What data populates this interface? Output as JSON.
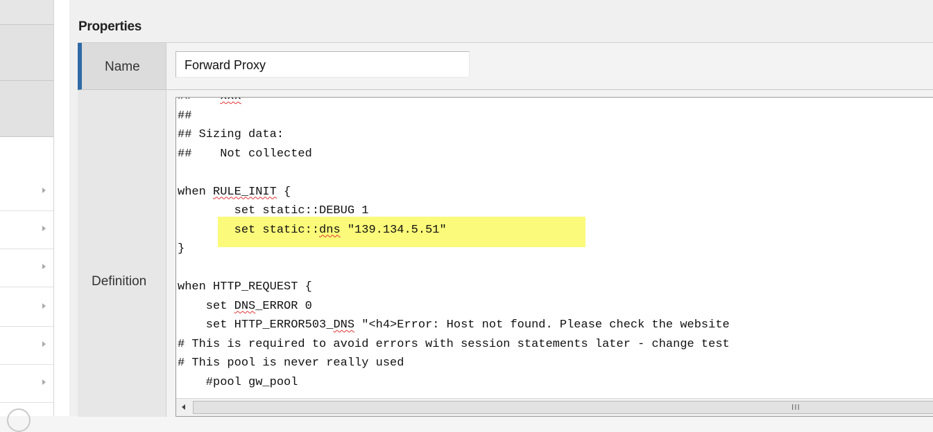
{
  "properties": {
    "title": "Properties",
    "name_label": "Name",
    "name_value": "Forward Proxy",
    "definition_label": "Definition"
  },
  "editor": {
    "lines": [
      [
        {
          "t": "##    "
        },
        {
          "t": "xxx",
          "sq": true
        }
      ],
      [
        {
          "t": "##"
        }
      ],
      [
        {
          "t": "## Sizing data:"
        }
      ],
      [
        {
          "t": "##    Not collected"
        }
      ],
      [
        {
          "t": ""
        }
      ],
      [
        {
          "t": "when "
        },
        {
          "t": "RULE_INIT",
          "sq": true
        },
        {
          "t": " {"
        }
      ],
      [
        {
          "t": "        set static::DEBUG 1"
        }
      ],
      [
        {
          "t": "        set static::"
        },
        {
          "t": "dns",
          "sq": true
        },
        {
          "t": " \"139.134.5.51\""
        }
      ],
      [
        {
          "t": "}"
        }
      ],
      [
        {
          "t": ""
        }
      ],
      [
        {
          "t": "when HTTP_REQUEST {"
        }
      ],
      [
        {
          "t": "    set "
        },
        {
          "t": "DNS",
          "sq": true
        },
        {
          "t": "_ERROR 0"
        }
      ],
      [
        {
          "t": "    set HTTP_ERROR503_"
        },
        {
          "t": "DNS",
          "sq": true
        },
        {
          "t": " \"<h4>Error: Host not found. Please check the website"
        }
      ],
      [
        {
          "t": "# This is required to avoid errors with session statements later - change test"
        }
      ],
      [
        {
          "t": "# This pool is never really used"
        }
      ],
      [
        {
          "t": "    #pool gw_pool"
        }
      ]
    ],
    "highlight_color": "#fbfa7a"
  },
  "scrollbar": {
    "grip": "III"
  },
  "colors": {
    "accent": "#2f6aa6"
  }
}
